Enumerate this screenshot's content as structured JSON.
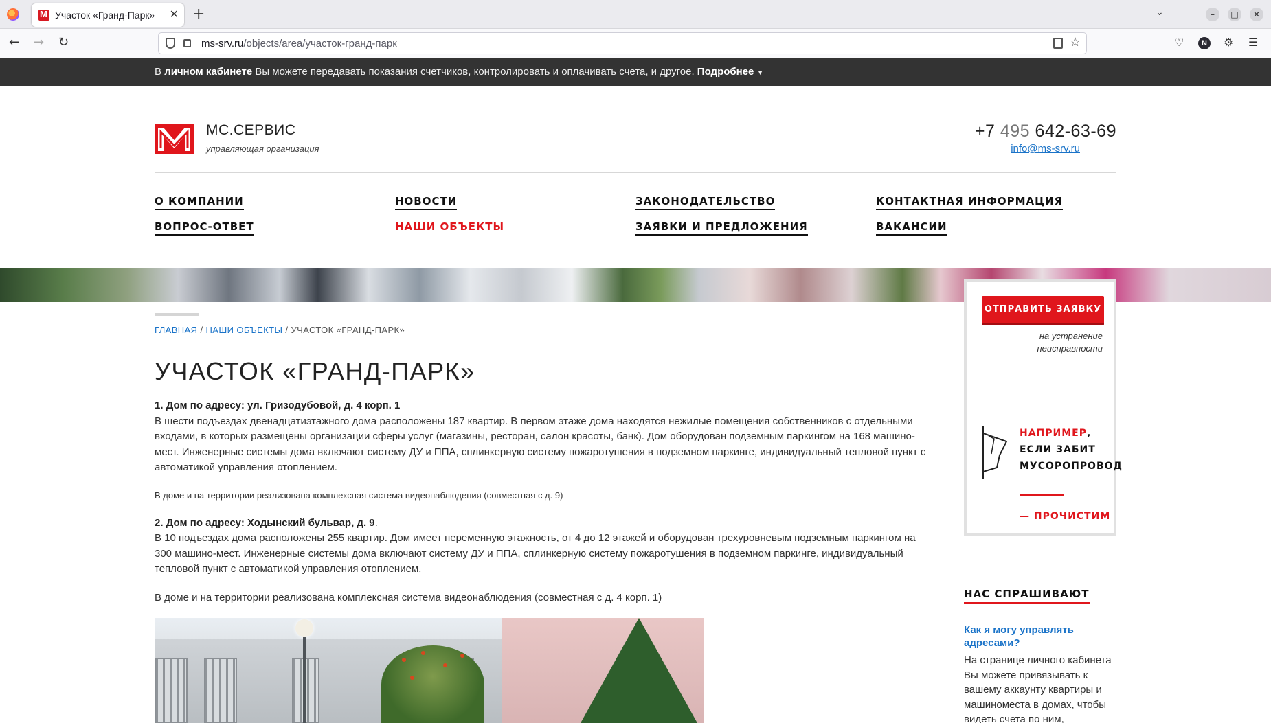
{
  "browser": {
    "tab_title": "Участок «Гранд-Парк» — ",
    "tab_close": "✕",
    "new_tab": "+",
    "url_host": "ms-srv.ru",
    "url_path": "/objects/area/участок-гранд-парк"
  },
  "infobar": {
    "prefix": "В ",
    "link": "личном кабинете",
    "text": " Вы можете передавать показания счетчиков, контролировать и оплачивать счета, и другое. ",
    "more": "Подробнее",
    "arrow": "▼"
  },
  "header": {
    "brand_name": "МС.СЕРВИС",
    "brand_sub": "управляющая организация",
    "phone_prefix": "+7 ",
    "phone_code": "495",
    "phone_number": " 642-63-69",
    "email": "info@ms-srv.ru"
  },
  "menu": {
    "about": "О КОМПАНИИ",
    "news": "НОВОСТИ",
    "law": "ЗАКОНОДАТЕЛЬСТВО",
    "contacts": "КОНТАКТНАЯ ИНФОРМАЦИЯ",
    "faq": "ВОПРОС-ОТВЕТ",
    "objects": "НАШИ ОБЪЕКТЫ",
    "requests": "ЗАЯВКИ И ПРЕДЛОЖЕНИЯ",
    "jobs": "ВАКАНСИИ"
  },
  "breadcrumb": {
    "home": "ГЛАВНАЯ",
    "sep": " / ",
    "objects": "НАШИ ОБЪЕКТЫ",
    "current": "УЧАСТОК «ГРАНД-ПАРК»"
  },
  "page_title": "УЧАСТОК «ГРАНД-ПАРК»",
  "content": {
    "h1": "1. Дом по адресу: ул. Гризодубовой, д. 4 корп. 1",
    "p1": "В шести подъездах двенадцатиэтажного дома расположены 187 квартир. В первом этаже дома находятся нежилые помещения собственников с отдельными входами, в которых размещены организации сферы услуг (магазины, ресторан, салон красоты, банк). Дом оборудован подземным паркингом на 168 машино-мест. Инженерные системы дома включают систему ДУ и ППА, сплинкерную систему пожаротушения в подземном паркинге, индивидуальный тепловой пункт с автоматикой управления отоплением.",
    "note1": "В доме и на территории реализована комплексная система видеонаблюдения (совместная с д. 9)",
    "h2": "2. Дом по адресу: Ходынский бульвар, д. 9",
    "h2_dot": ".",
    "p2": "В 10 подъездах дома расположены 255 квартир. Дом имеет переменную этажность, от 4 до 12 этажей и оборудован трехуровневым подземным паркингом на 300 машино-мест. Инженерные системы дома включают систему ДУ и ППА, сплинкерную систему пожаротушения в подземном паркинге, индивидуальный тепловой пункт с автоматикой управления отоплением.",
    "note2": "В доме и на территории реализована комплексная система видеонаблюдения (совместная с д. 4 корп. 1)"
  },
  "sidebar": {
    "button": "ОТПРАВИТЬ ЗАЯВКУ",
    "button_sub": "на устранение неисправности",
    "example_red": "НАПРИМЕР",
    "example_comma": ",",
    "example_line2": "ЕСЛИ ЗАБИТ",
    "example_line3": "МУСОРОПРОВОД",
    "cta": "— ПРОЧИСТИМ",
    "faq_heading": "НАС СПРАШИВАЮТ",
    "faq_question": "Как я могу управлять адресами?",
    "faq_answer": "На странице личного кабинета Вы можете привязывать к вашему аккаунту квартиры и машиноместа в домах, чтобы видеть счета по ним,"
  },
  "colors": {
    "brand_red": "#e0161c",
    "link_blue": "#1a73c8",
    "infobar_bg": "#333333"
  }
}
